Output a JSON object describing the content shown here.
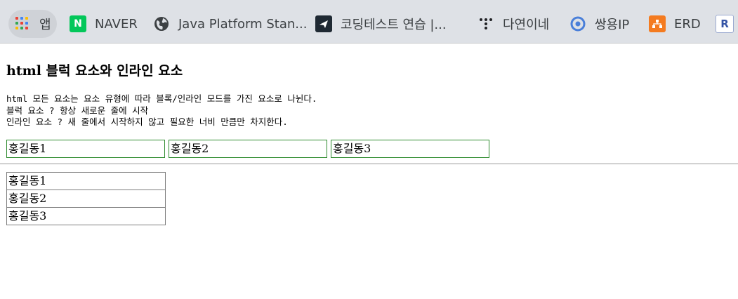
{
  "bookmarks": [
    {
      "label": "앱",
      "icon": "apps-grid-icon"
    },
    {
      "label": "NAVER",
      "icon": "naver-icon"
    },
    {
      "label": "Java Platform Stan...",
      "icon": "globe-icon"
    },
    {
      "label": "코딩테스트 연습 |...",
      "icon": "programmers-icon"
    },
    {
      "label": "다연이네",
      "icon": "dots-logo-icon"
    },
    {
      "label": "쌍용IP",
      "icon": "circle-arrow-icon"
    },
    {
      "label": "ERD",
      "icon": "erd-icon"
    },
    {
      "label": "",
      "icon": "r-logo-icon"
    }
  ],
  "colors": {
    "bookmark_bar_bg": "#dee1e6",
    "inline_border": "#2e8b2e",
    "block_border": "#7d7d7d"
  },
  "page": {
    "heading": "html 블럭 요소와 인라인 요소",
    "desc_lines": [
      "html 모든 요소는 요소 유형에 따라 블록/인라인 모드를 가진 요소로 나뉜다.",
      "블럭 요소 ? 항상 새로운 줄에 시작",
      "인라인 요소 ? 새 줄에서 시작하지 않고 필요한 너비 만큼만 차지한다."
    ],
    "inline_items": [
      "홍길동1",
      "홍길동2",
      "홍길동3"
    ],
    "block_items": [
      "홍길동1",
      "홍길동2",
      "홍길동3"
    ]
  }
}
